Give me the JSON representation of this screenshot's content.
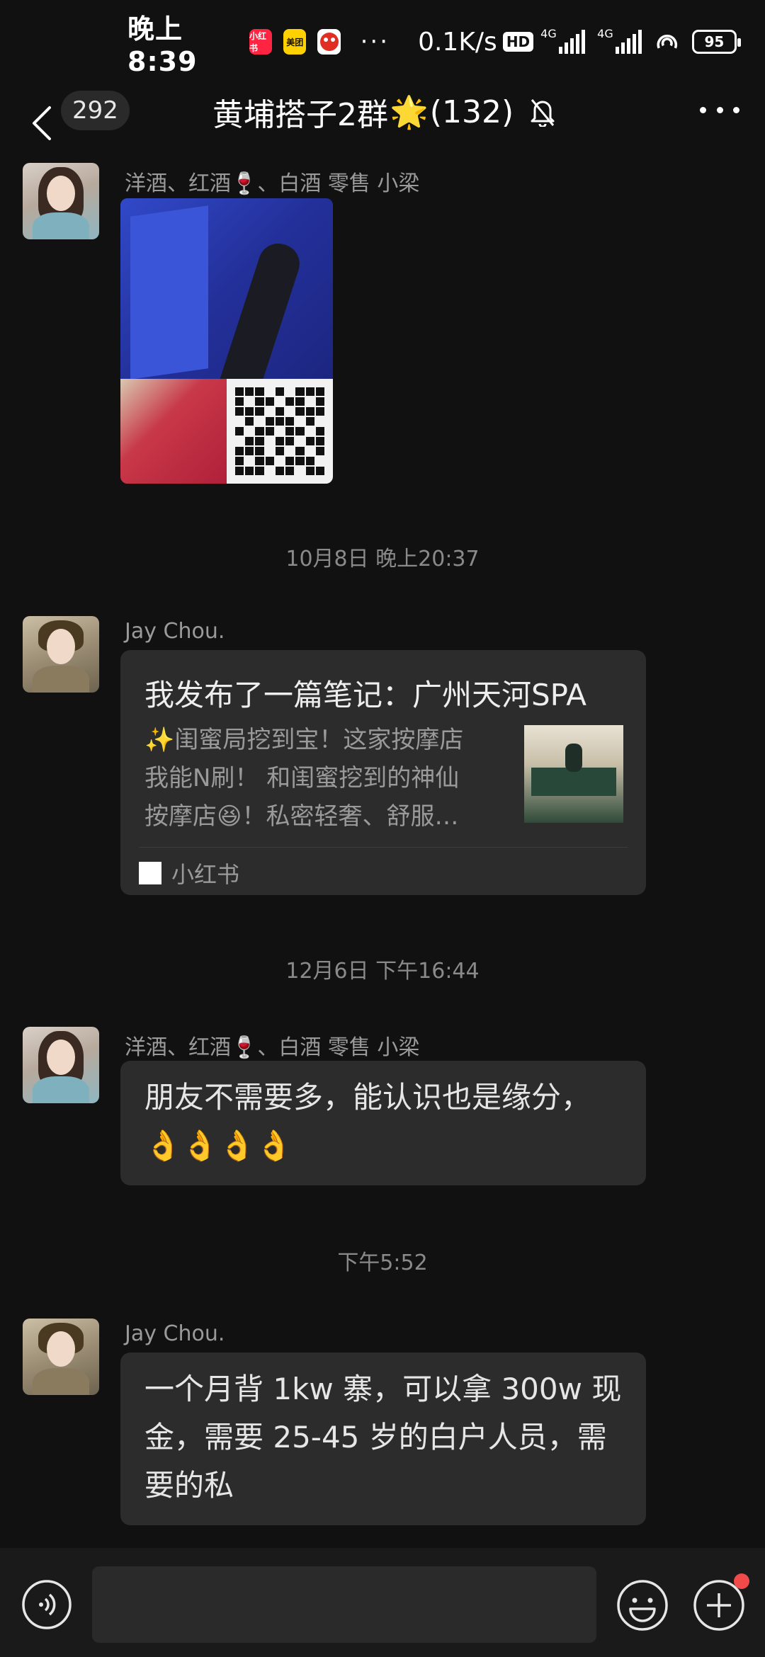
{
  "status_bar": {
    "time": "晚上8:39",
    "apps": [
      {
        "icon": "xiaohongshu-app-icon",
        "text": "小红书",
        "color": "#ff2442"
      },
      {
        "icon": "meituan-app-icon",
        "text": "美团",
        "color": "#ffd100"
      },
      {
        "icon": "pinduoduo-app-icon",
        "text": "",
        "color": "#e02e24"
      }
    ],
    "more": "···",
    "network_speed": "0.1K/s",
    "hd": "HD",
    "signal1": "4G",
    "signal2": "4G",
    "battery": "95"
  },
  "nav": {
    "unread_count": "292",
    "title_prefix": "黄埔搭子2群",
    "title_star": "🌟",
    "title_count": "(132)"
  },
  "messages": [
    {
      "type": "image",
      "sender": "洋酒、红酒🍷、白酒 零售 小梁"
    },
    {
      "type": "timestamp",
      "text": "10月8日 晚上20:37"
    },
    {
      "type": "share",
      "sender": "Jay Chou.",
      "title": "我发布了一篇笔记：广州天河SPA",
      "desc_line1": "✨闺蜜局挖到宝！这家按摩店",
      "desc_line2": "我能N刷！ 和闺蜜挖到的神仙",
      "desc_line3": "按摩店😆！私密轻奢、舒服…",
      "source": "小红书"
    },
    {
      "type": "timestamp",
      "text": "12月6日 下午16:44"
    },
    {
      "type": "text",
      "sender": "洋酒、红酒🍷、白酒 零售 小梁",
      "line1": "朋友不需要多，能认识也是缘分，",
      "line2": "👌👌👌👌"
    },
    {
      "type": "timestamp",
      "text": "下午5:52"
    },
    {
      "type": "text",
      "sender": "Jay Chou.",
      "line1": "一个月背 1kw 寨，可以拿 300w 现",
      "line2": "金，需要 25-45 岁的白户人员，需",
      "line3": "要的私"
    }
  ],
  "input": {
    "placeholder": ""
  },
  "colors": {
    "background": "#111111",
    "bubble": "#2c2c2c",
    "accent_dot": "#f04a4a"
  }
}
